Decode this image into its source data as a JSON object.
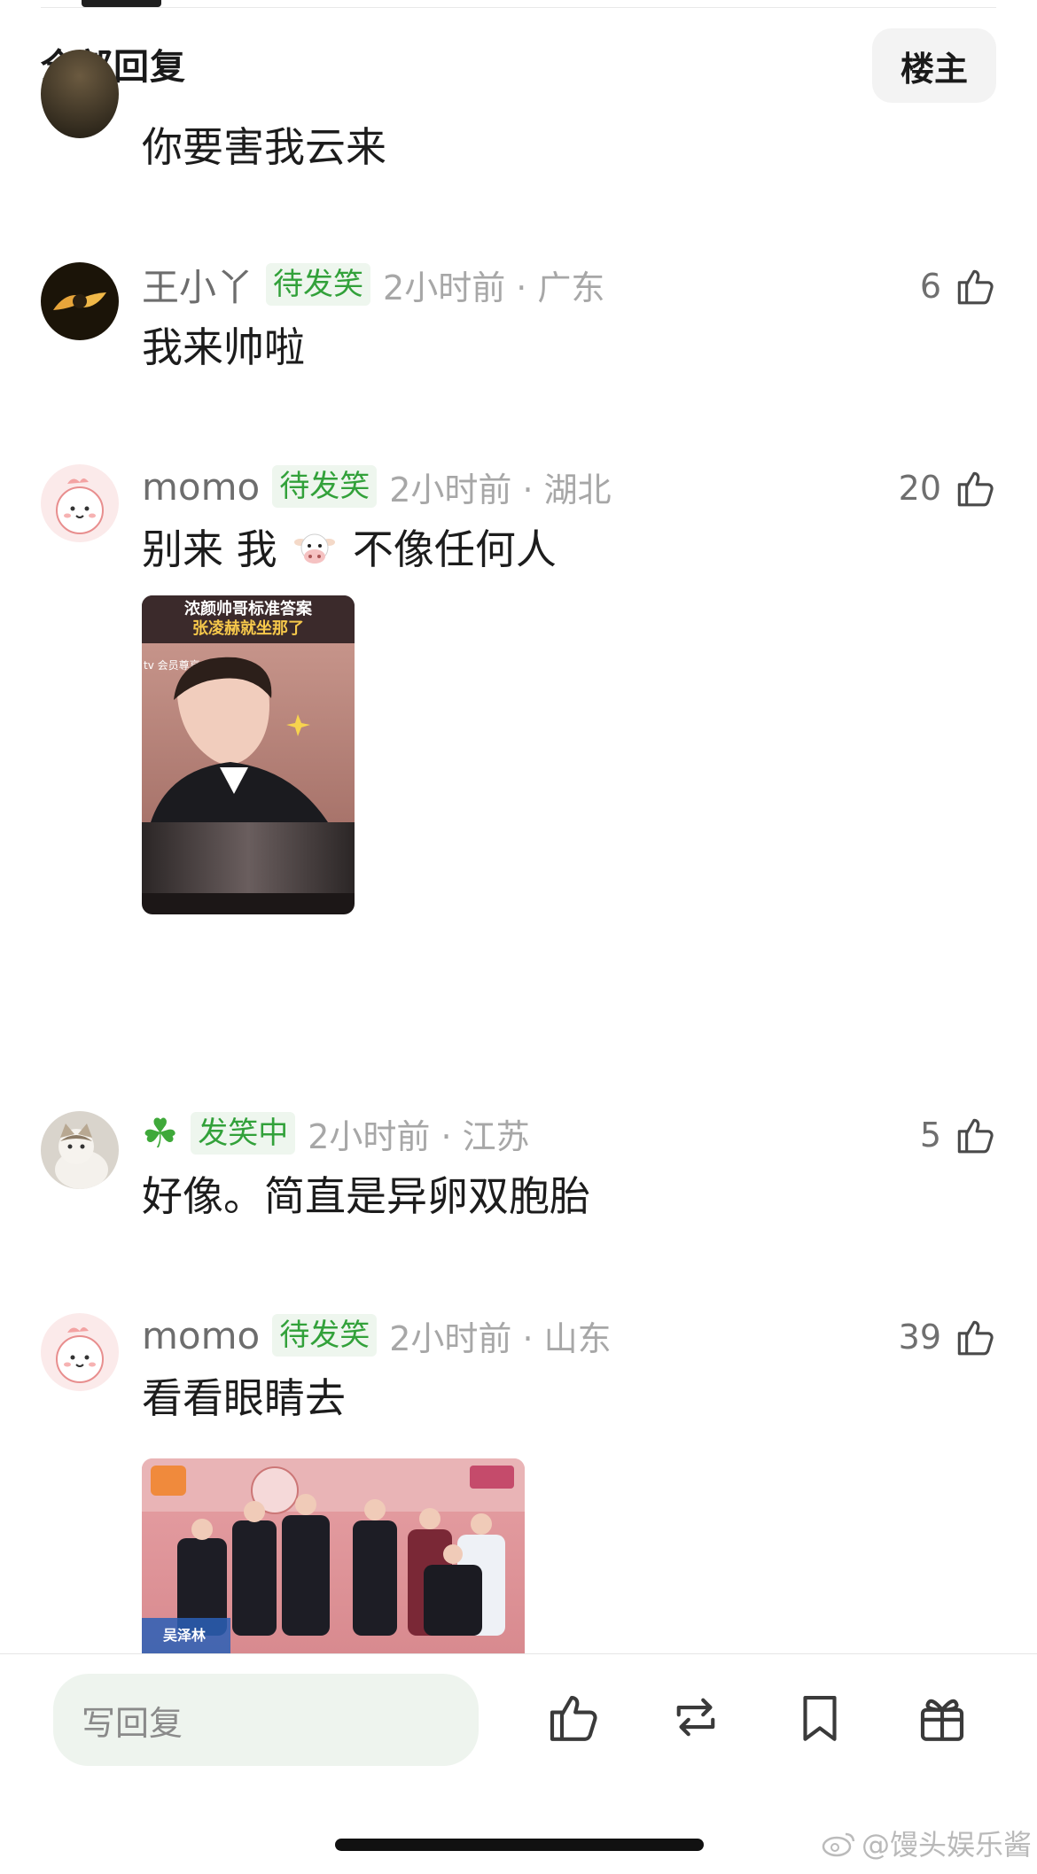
{
  "header": {
    "title": "全部回复",
    "op_button": "楼主"
  },
  "partial_comment": {
    "content": "你要害我云来"
  },
  "comments": [
    {
      "username": "王小丫",
      "badge": "待发笑",
      "time_location": "2小时前 · 广东",
      "likes": "6",
      "content": "我来帅啦",
      "avatar_icon": "koi-fish-avatar"
    },
    {
      "username": "momo",
      "badge": "待发笑",
      "time_location": "2小时前 · 湖北",
      "likes": "20",
      "content_before": "别来 我",
      "content_emoji": "cow-face-emoji",
      "content_after": "不像任何人",
      "avatar_icon": "pink-bird-avatar",
      "image": {
        "caption_line1": "浓颜帅哥标准答案",
        "caption_line2": "张凌赫就坐那了",
        "tv_label": "tv 会员尊享"
      }
    },
    {
      "username": "☘",
      "badge": "发笑中",
      "time_location": "2小时前 · 江苏",
      "likes": "5",
      "content": "好像。简直是异卵双胞胎",
      "avatar_icon": "cat-avatar"
    },
    {
      "username": "momo",
      "badge": "待发笑",
      "time_location": "2小时前 · 山东",
      "likes": "39",
      "content": "看看眼睛去",
      "avatar_icon": "pink-bird-avatar",
      "image": {
        "label_bottom": "吴泽林"
      }
    }
  ],
  "bottom_bar": {
    "reply_placeholder": "写回复",
    "icons": [
      "like-icon",
      "repost-icon",
      "bookmark-icon",
      "gift-icon"
    ]
  },
  "watermark": "@馒头娱乐酱",
  "colors": {
    "badge_green": "#32a13a",
    "badge_bg": "#eef6ee",
    "reply_box_bg": "#eef4ee",
    "meta_gray": "#a7a7a7"
  }
}
